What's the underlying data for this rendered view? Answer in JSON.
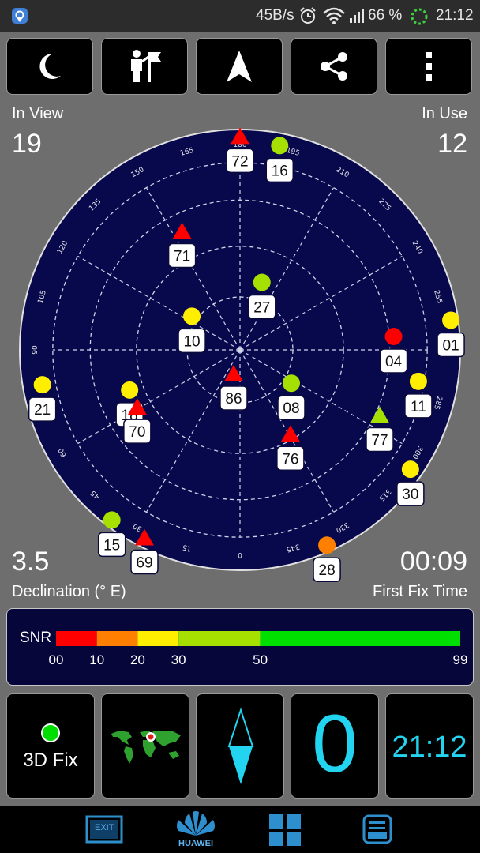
{
  "status_bar": {
    "net_speed": "45B/s",
    "battery": "66 %",
    "time": "21:12",
    "icons": [
      "location-icon",
      "alarm-icon",
      "wifi-icon",
      "signal-icon",
      "battery-icon",
      "loading-ring-icon"
    ]
  },
  "toolbar": {
    "buttons": [
      {
        "icon": "moon-icon"
      },
      {
        "icon": "person-flag-icon"
      },
      {
        "icon": "navigation-arrow-icon"
      },
      {
        "icon": "share-icon"
      },
      {
        "icon": "more-vertical-icon"
      }
    ]
  },
  "stats": {
    "in_view_label": "In View",
    "in_view_value": "19",
    "in_use_label": "In Use",
    "in_use_value": "12",
    "declination_value": "3.5",
    "declination_label": "Declination (° E)",
    "first_fix_value": "00:09",
    "first_fix_label": "First Fix Time"
  },
  "sky_plot": {
    "background": "#08084d",
    "azimuth_labels": [
      "0",
      "15",
      "30",
      "45",
      "60",
      "75",
      "90",
      "105",
      "120",
      "135",
      "150",
      "165",
      "180",
      "195",
      "210",
      "225",
      "240",
      "255",
      "270",
      "285",
      "300",
      "315",
      "330",
      "345"
    ],
    "satellites": [
      {
        "id": "72",
        "az": 180,
        "el": 0,
        "shape": "triangle",
        "color": "#ff0000"
      },
      {
        "id": "16",
        "az": 191,
        "el": 5,
        "shape": "circle",
        "color": "#a5e000"
      },
      {
        "id": "71",
        "az": 154,
        "el": 36,
        "shape": "triangle",
        "color": "#ff0000"
      },
      {
        "id": "27",
        "az": 198,
        "el": 61,
        "shape": "circle",
        "color": "#a5e000"
      },
      {
        "id": "10",
        "az": 125,
        "el": 66,
        "shape": "circle",
        "color": "#ffee00"
      },
      {
        "id": "04",
        "az": 265,
        "el": 27,
        "shape": "circle",
        "color": "#ff0000"
      },
      {
        "id": "01",
        "az": 262,
        "el": 3,
        "shape": "circle",
        "color": "#ffee00"
      },
      {
        "id": "11",
        "az": 280,
        "el": 16,
        "shape": "circle",
        "color": "#ffee00"
      },
      {
        "id": "77",
        "az": 295,
        "el": 27,
        "shape": "triangle",
        "color": "#a5e000"
      },
      {
        "id": "08",
        "az": 303,
        "el": 65,
        "shape": "circle",
        "color": "#a5e000"
      },
      {
        "id": "76",
        "az": 329,
        "el": 50,
        "shape": "triangle",
        "color": "#ff0000"
      },
      {
        "id": "86",
        "az": 15,
        "el": 80,
        "shape": "triangle",
        "color": "#ff0000"
      },
      {
        "id": "21",
        "az": 80,
        "el": 8,
        "shape": "circle",
        "color": "#ffee00"
      },
      {
        "id": "18",
        "az": 70,
        "el": 42,
        "shape": "circle",
        "color": "#ffee00"
      },
      {
        "id": "70",
        "az": 61,
        "el": 42,
        "shape": "triangle",
        "color": "#ff0000"
      },
      {
        "id": "30",
        "az": 305,
        "el": 5,
        "shape": "circle",
        "color": "#ffee00"
      },
      {
        "id": "15",
        "az": 37,
        "el": 3,
        "shape": "circle",
        "color": "#a5e000"
      },
      {
        "id": "69",
        "az": 27,
        "el": 4,
        "shape": "triangle",
        "color": "#ff0000"
      },
      {
        "id": "28",
        "az": 336,
        "el": 0,
        "shape": "circle",
        "color": "#ff8000"
      }
    ]
  },
  "snr": {
    "label": "SNR",
    "ticks": [
      "00",
      "10",
      "20",
      "30",
      "50",
      "99"
    ],
    "segments": [
      {
        "from": 0,
        "to": 10,
        "color": "#ff0000"
      },
      {
        "from": 10,
        "to": 20,
        "color": "#ff8000"
      },
      {
        "from": 20,
        "to": 30,
        "color": "#ffee00"
      },
      {
        "from": 30,
        "to": 50,
        "color": "#a5e000"
      },
      {
        "from": 50,
        "to": 99,
        "color": "#00e000"
      }
    ]
  },
  "bottom": {
    "fix_label": "3D Fix",
    "fix_dot_color": "#00dd00",
    "map_icon": "world-map-icon",
    "compass_icon": "compass-needle-icon",
    "speed_value": "0",
    "clock_value": "21:12",
    "accent": "#22d4f0"
  },
  "nav_bar": {
    "exit_label": "EXIT",
    "brand_label": "HUAWEI",
    "icons": [
      "exit-icon",
      "huawei-logo-icon",
      "apps-grid-icon",
      "notification-tray-icon"
    ]
  }
}
